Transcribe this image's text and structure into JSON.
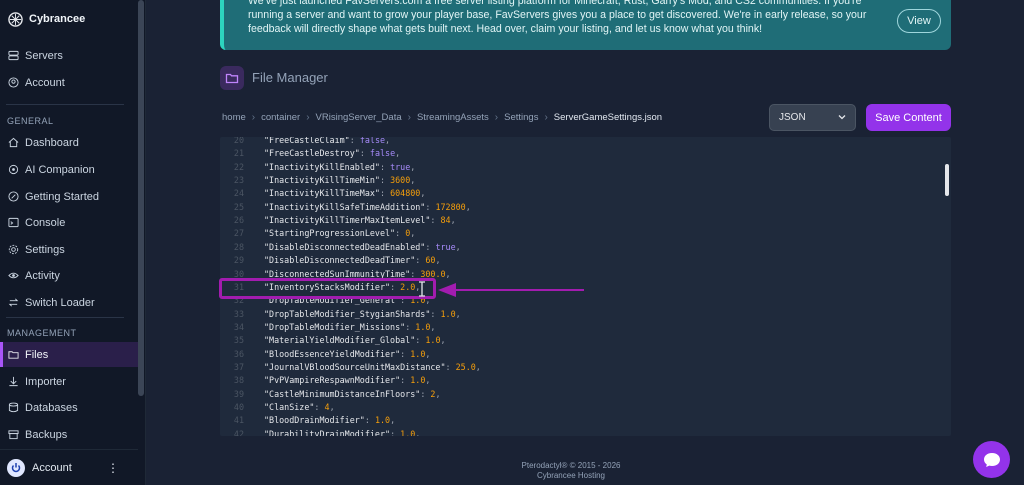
{
  "brand": {
    "name": "Cybrancee"
  },
  "sidebar": {
    "top_items": [
      {
        "label": "Servers",
        "icon": "server-icon"
      },
      {
        "label": "Account",
        "icon": "account-icon"
      }
    ],
    "general_label": "GENERAL",
    "general_items": [
      {
        "label": "Dashboard",
        "icon": "dashboard-icon"
      },
      {
        "label": "AI Companion",
        "icon": "ai-icon"
      },
      {
        "label": "Getting Started",
        "icon": "rocket-icon"
      },
      {
        "label": "Console",
        "icon": "console-icon"
      },
      {
        "label": "Settings",
        "icon": "gear-icon"
      },
      {
        "label": "Activity",
        "icon": "eye-icon"
      },
      {
        "label": "Switch Loader",
        "icon": "switch-icon"
      }
    ],
    "management_label": "MANAGEMENT",
    "management_items": [
      {
        "label": "Files",
        "icon": "folder-icon",
        "active": true
      },
      {
        "label": "Importer",
        "icon": "download-icon"
      },
      {
        "label": "Databases",
        "icon": "database-icon"
      },
      {
        "label": "Backups",
        "icon": "backup-icon"
      }
    ],
    "account_label": "Account"
  },
  "banner": {
    "line1": "We've just launched FavServers.com a free server listing platform for Minecraft, Rust, Garry's Mod, and CS2 communities. If you're",
    "line2": "running a server and want to grow your player base, FavServers gives you a place to get discovered. We're in early release, so your",
    "line3": "feedback will directly shape what gets built next. Head over, claim your listing, and let us know what you think!",
    "view_label": "View"
  },
  "page": {
    "title": "File Manager"
  },
  "breadcrumb": [
    "home",
    "container",
    "VRisingServer_Data",
    "StreamingAssets",
    "Settings",
    "ServerGameSettings.json"
  ],
  "toolbar": {
    "format": "JSON",
    "save_label": "Save Content"
  },
  "editor": {
    "lines": [
      {
        "n": "20",
        "key": "\"FreeCastleClaim\"",
        "val": "false",
        "type": "bool"
      },
      {
        "n": "21",
        "key": "\"FreeCastleDestroy\"",
        "val": "false",
        "type": "bool"
      },
      {
        "n": "22",
        "key": "\"InactivityKillEnabled\"",
        "val": "true",
        "type": "bool"
      },
      {
        "n": "23",
        "key": "\"InactivityKillTimeMin\"",
        "val": "3600",
        "type": "num"
      },
      {
        "n": "24",
        "key": "\"InactivityKillTimeMax\"",
        "val": "604800",
        "type": "num"
      },
      {
        "n": "25",
        "key": "\"InactivityKillSafeTimeAddition\"",
        "val": "172800",
        "type": "num"
      },
      {
        "n": "26",
        "key": "\"InactivityKillTimerMaxItemLevel\"",
        "val": "84",
        "type": "num"
      },
      {
        "n": "27",
        "key": "\"StartingProgressionLevel\"",
        "val": "0",
        "type": "num"
      },
      {
        "n": "28",
        "key": "\"DisableDisconnectedDeadEnabled\"",
        "val": "true",
        "type": "bool"
      },
      {
        "n": "29",
        "key": "\"DisableDisconnectedDeadTimer\"",
        "val": "60",
        "type": "num"
      },
      {
        "n": "30",
        "key": "\"DisconnectedSunImmunityTime\"",
        "val": "300.0",
        "type": "num"
      },
      {
        "n": "31",
        "key": "\"InventoryStacksModifier\"",
        "val": "2.0",
        "type": "num"
      },
      {
        "n": "32",
        "key": "\"DropTableModifier_General\"",
        "val": "1.0",
        "type": "num"
      },
      {
        "n": "33",
        "key": "\"DropTableModifier_StygianShards\"",
        "val": "1.0",
        "type": "num"
      },
      {
        "n": "34",
        "key": "\"DropTableModifier_Missions\"",
        "val": "1.0",
        "type": "num"
      },
      {
        "n": "35",
        "key": "\"MaterialYieldModifier_Global\"",
        "val": "1.0",
        "type": "num"
      },
      {
        "n": "36",
        "key": "\"BloodEssenceYieldModifier\"",
        "val": "1.0",
        "type": "num"
      },
      {
        "n": "37",
        "key": "\"JournalVBloodSourceUnitMaxDistance\"",
        "val": "25.0",
        "type": "num"
      },
      {
        "n": "38",
        "key": "\"PvPVampireRespawnModifier\"",
        "val": "1.0",
        "type": "num"
      },
      {
        "n": "39",
        "key": "\"CastleMinimumDistanceInFloors\"",
        "val": "2",
        "type": "num"
      },
      {
        "n": "40",
        "key": "\"ClanSize\"",
        "val": "4",
        "type": "num"
      },
      {
        "n": "41",
        "key": "\"BloodDrainModifier\"",
        "val": "1.0",
        "type": "num"
      },
      {
        "n": "42",
        "key": "\"DurabilityDrainModifier\"",
        "val": "1.0",
        "type": "num"
      }
    ]
  },
  "footer": {
    "line1": "Pterodactyl® © 2015 - 2026",
    "line2": "Cybrancee Hosting"
  },
  "colors": {
    "accent": "#9333ea",
    "banner": "#1f6d77",
    "highlight": "#a21caf"
  }
}
